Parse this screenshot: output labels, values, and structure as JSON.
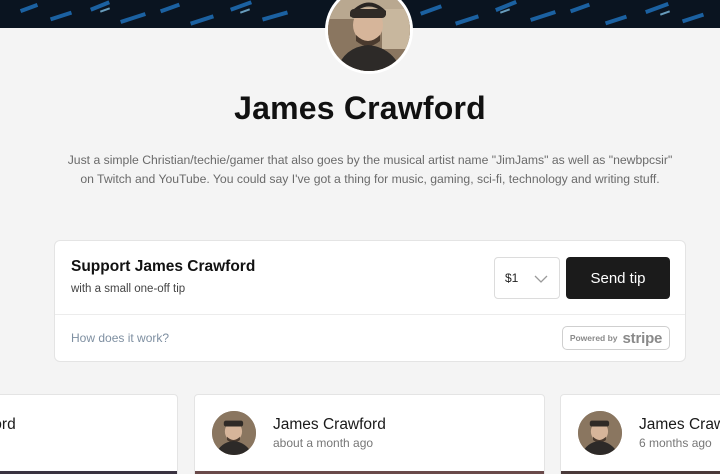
{
  "profile": {
    "name": "James Crawford",
    "bio": "Just a simple Christian/techie/gamer that also goes by the musical artist name \"JimJams\" as well as \"newbpcsir\" on Twitch and YouTube. You could say I've got a thing for music, gaming, sci-fi, technology and writing stuff."
  },
  "tip": {
    "title": "Support James Crawford",
    "subtitle": "with a small one-off tip",
    "amount": "$1",
    "send_label": "Send tip",
    "how_link": "How does it work?",
    "powered_by": "Powered by",
    "stripe": "stripe"
  },
  "posts": [
    {
      "author": "ford",
      "time": ""
    },
    {
      "author": "James Crawford",
      "time": "about a month ago"
    },
    {
      "author": "James Craw",
      "time": "6 months ago"
    }
  ],
  "colors": {
    "page_bg": "#f4f4f4",
    "button_bg": "#1b1b1b",
    "link": "#7e8fa1"
  }
}
